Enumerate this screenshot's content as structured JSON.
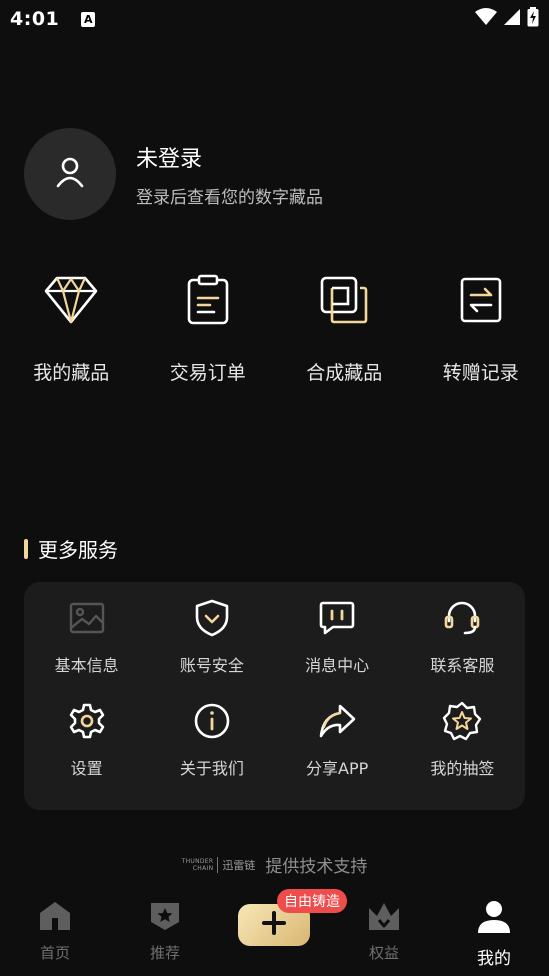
{
  "status_bar": {
    "time": "4:01",
    "notification_badge": "A"
  },
  "profile": {
    "title": "未登录",
    "subtitle": "登录后查看您的数字藏品"
  },
  "quick_actions": [
    {
      "label": "我的藏品",
      "icon": "diamond-icon"
    },
    {
      "label": "交易订单",
      "icon": "clipboard-icon"
    },
    {
      "label": "合成藏品",
      "icon": "layers-icon"
    },
    {
      "label": "转赠记录",
      "icon": "transfer-icon"
    }
  ],
  "more_services": {
    "title": "更多服务",
    "items": [
      {
        "label": "基本信息",
        "icon": "image-icon"
      },
      {
        "label": "账号安全",
        "icon": "shield-icon"
      },
      {
        "label": "消息中心",
        "icon": "message-icon"
      },
      {
        "label": "联系客服",
        "icon": "headset-icon"
      },
      {
        "label": "设置",
        "icon": "gear-icon"
      },
      {
        "label": "关于我们",
        "icon": "info-icon"
      },
      {
        "label": "分享APP",
        "icon": "share-icon"
      },
      {
        "label": "我的抽签",
        "icon": "star-badge-icon"
      }
    ]
  },
  "powered_by": {
    "logo_en_1": "THUNDER",
    "logo_en_2": "CHAIN",
    "logo_cn": "迅雷链",
    "text": "提供技术支持"
  },
  "tabbar": {
    "home": "首页",
    "recommend": "推荐",
    "mint_badge": "自由铸造",
    "rights": "权益",
    "mine": "我的"
  },
  "colors": {
    "accent": "#f3d79a",
    "background": "#0e0e0e",
    "card": "#1c1c1c",
    "badge": "#ef4c4c"
  }
}
